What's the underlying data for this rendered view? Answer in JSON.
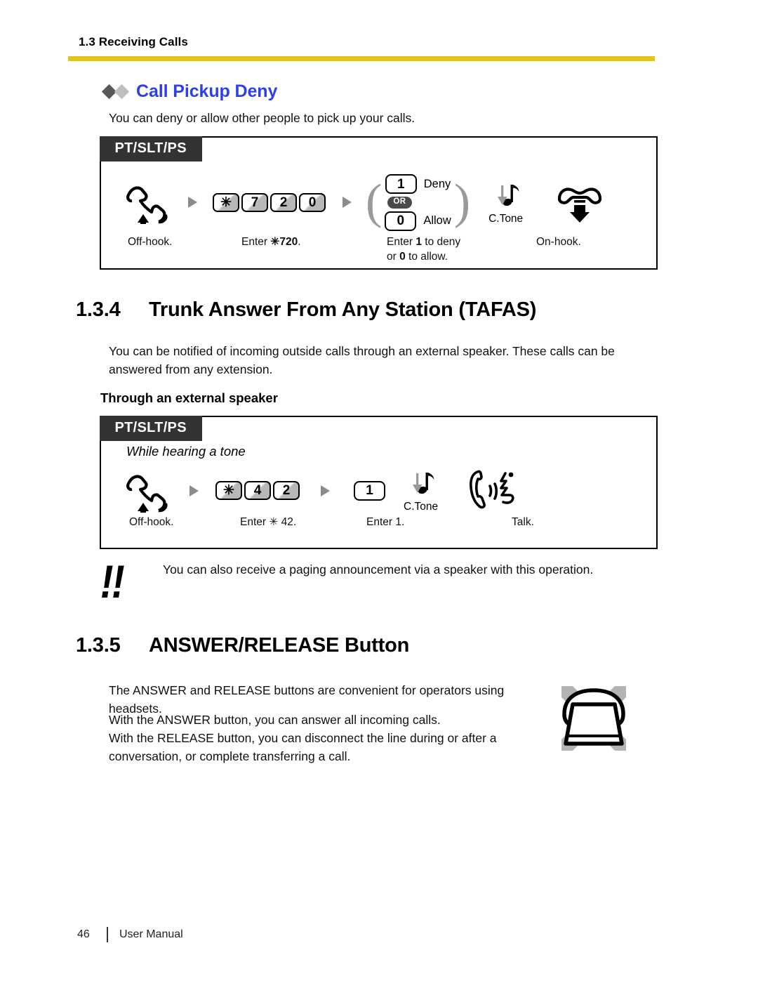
{
  "header": {
    "running_head": "1.3 Receiving Calls",
    "rule_color": "#E3C418"
  },
  "call_pickup_deny": {
    "title": "Call Pickup Deny",
    "title_color": "#2B3FF0",
    "intro": "You can deny or allow other people to pick up your calls.",
    "box": {
      "tab": "PT/SLT/PS",
      "steps": [
        {
          "icon": "off-hook-handset-icon",
          "caption": "Off-hook."
        },
        {
          "keys": [
            "✳",
            "7",
            "2",
            "0"
          ],
          "caption_prefix": "Enter ",
          "caption_code": "✳720",
          "caption_suffix": "."
        },
        {
          "choice": {
            "option1_key": "1",
            "option1_label": "Deny",
            "or_label": "OR",
            "option2_key": "0",
            "option2_label": "Allow"
          },
          "caption_line1_a": "Enter ",
          "caption_line1_b": "1",
          "caption_line1_c": " to deny",
          "caption_line2_a": "or ",
          "caption_line2_b": "0",
          "caption_line2_c": " to allow."
        },
        {
          "icon": "confirmation-tone-icon",
          "label": "C.Tone"
        },
        {
          "icon": "on-hook-handset-icon",
          "caption": "On-hook."
        }
      ]
    }
  },
  "tafas": {
    "number": "1.3.4",
    "title": "Trunk Answer From Any Station (TAFAS)",
    "body": "You can be notified of incoming outside calls through an external speaker. These calls can be answered from any extension.",
    "subhead": "Through an external speaker",
    "box": {
      "tab": "PT/SLT/PS",
      "condition": "While hearing a tone",
      "steps": [
        {
          "icon": "off-hook-handset-icon",
          "caption": "Off-hook."
        },
        {
          "keys": [
            "✳",
            "4",
            "2"
          ],
          "caption_prefix": "Enter ",
          "caption_code": "✳ 42",
          "caption_suffix": "."
        },
        {
          "key": "1",
          "caption": "Enter 1."
        },
        {
          "icon": "confirmation-tone-icon",
          "label": "C.Tone"
        },
        {
          "icon": "talk-handset-icon",
          "caption": "Talk."
        }
      ]
    },
    "note": {
      "icon": "double-exclamation-note-icon",
      "text": "You can also receive a paging announcement via a speaker with this operation."
    }
  },
  "answer_release": {
    "number": "1.3.5",
    "title": "ANSWER/RELEASE Button",
    "lines": [
      "The ANSWER and RELEASE buttons are convenient for operators using headsets.",
      "With the ANSWER button, you can answer all incoming calls.",
      "With the RELEASE button, you can disconnect the line during or after a conversation, or complete transferring a call."
    ],
    "illustration": "headset-icon"
  },
  "footer": {
    "page_number": "46",
    "document_title": "User Manual"
  }
}
